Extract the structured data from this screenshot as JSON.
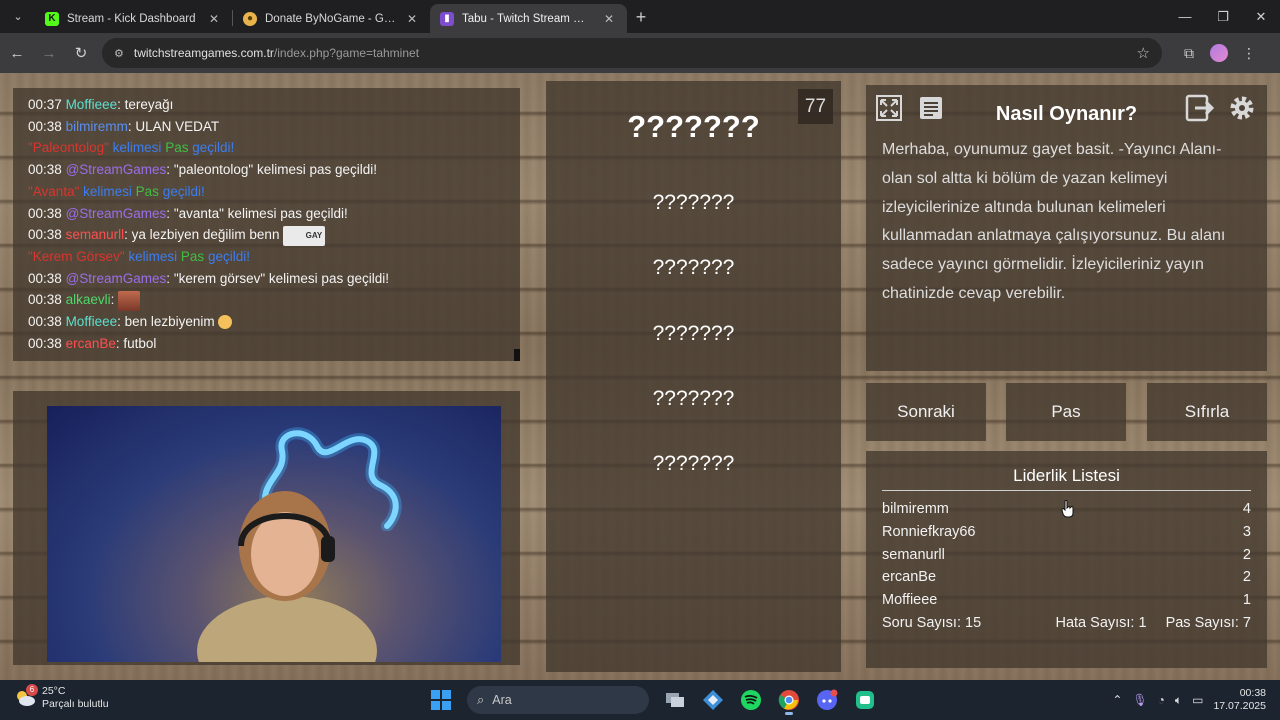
{
  "browser": {
    "tabs": [
      {
        "title": "Stream - Kick Dashboard",
        "active": false
      },
      {
        "title": "Donate ByNoGame - Gelen/Gid",
        "active": false
      },
      {
        "title": "Tabu - Twitch Stream Games",
        "active": true
      }
    ],
    "url_host": "twitchstreamgames.com.tr",
    "url_path": "/index.php?game=tahminet"
  },
  "chat": [
    {
      "time": "00:37",
      "user": "Moffieee",
      "color": "teal",
      "text": "tereyağı"
    },
    {
      "time": "00:38",
      "user": "bilmiremm",
      "color": "blue",
      "text": "ULAN VEDAT"
    },
    {
      "system": true,
      "word": "\"Paleontolog\"",
      "mid": "kelimesi",
      "pas": "Pas",
      "end": "geçildi!"
    },
    {
      "time": "00:38",
      "user": "@StreamGames",
      "color": "purple",
      "text": "\"paleontolog\" kelimesi pas geçildi!"
    },
    {
      "system": true,
      "word": "\"Avanta\"",
      "mid": "kelimesi",
      "pas": "Pas",
      "end": "geçildi!"
    },
    {
      "time": "00:38",
      "user": "@StreamGames",
      "color": "purple",
      "text": "\"avanta\" kelimesi pas geçildi!"
    },
    {
      "time": "00:38",
      "user": "semanurll",
      "color": "red",
      "text": "ya lezbiyen değilim benn",
      "emote": "GAY"
    },
    {
      "system": true,
      "word": "\"Kerem Görsev\"",
      "mid": "kelimesi",
      "pas": "Pas",
      "end": "geçildi!"
    },
    {
      "time": "00:38",
      "user": "@StreamGames",
      "color": "purple",
      "text": "\"kerem görsev\" kelimesi pas geçildi!"
    },
    {
      "time": "00:38",
      "user": "alkaevli",
      "color": "green",
      "text": ""
    },
    {
      "time": "00:38",
      "user": "Moffieee",
      "color": "teal",
      "text": "ben lezbiyenim"
    },
    {
      "time": "00:38",
      "user": "ercanBe",
      "color": "red",
      "text": "futbol"
    }
  ],
  "game": {
    "counter": "77",
    "main_word": "???????",
    "taboo_words": [
      "???????",
      "???????",
      "???????",
      "???????",
      "???????"
    ]
  },
  "howto": {
    "title": "Nasıl Oynanır?",
    "text": "Merhaba, oyunumuz gayet basit. -Yayıncı Alanı- olan sol altta ki bölüm de yazan kelimeyi izleyicilerinize altında bulunan kelimeleri kullanmadan anlatmaya çalışıyorsunuz. Bu alanı sadece yayıncı görmelidir. İzleyicileriniz yayın chatinizde cevap verebilir."
  },
  "buttons": {
    "next": "Sonraki",
    "pass": "Pas",
    "reset": "Sıfırla"
  },
  "leaderboard": {
    "title": "Liderlik Listesi",
    "rows": [
      {
        "name": "bilmiremm",
        "score": "4"
      },
      {
        "name": "Ronniefkray66",
        "score": "3"
      },
      {
        "name": "semanurll",
        "score": "2"
      },
      {
        "name": "ercanBe",
        "score": "2"
      },
      {
        "name": "Moffieee",
        "score": "1"
      }
    ],
    "question_count": "Soru Sayısı: 15",
    "error_count": "Hata Sayısı: 1",
    "pass_count": "Pas Sayısı: 7"
  },
  "taskbar": {
    "temp": "25°C",
    "weather": "Parçalı bulutlu",
    "weather_badge": "6",
    "search_placeholder": "Ara",
    "time": "00:38",
    "date": "17.07.2025"
  },
  "colors": {
    "teal": "#5be0d0",
    "blue": "#5a8ff0",
    "red": "#ff4f4f",
    "purple": "#9b6ee8",
    "green": "#4ed86a"
  }
}
